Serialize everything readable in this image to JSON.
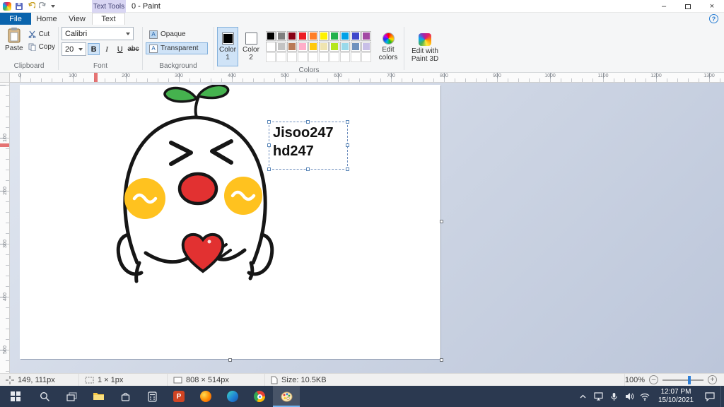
{
  "titlebar": {
    "context_badge": "Text Tools",
    "title": "0 - Paint",
    "minimize": "–",
    "close": "×"
  },
  "tabs": {
    "file": "File",
    "home": "Home",
    "view": "View",
    "text": "Text",
    "help": "?"
  },
  "ribbon": {
    "clipboard": {
      "label": "Clipboard",
      "paste": "Paste",
      "cut": "Cut",
      "copy": "Copy"
    },
    "font": {
      "label": "Font",
      "family": "Calibri",
      "size": "20",
      "bold": "B",
      "italic": "I",
      "underline": "U",
      "strike": "abc"
    },
    "background": {
      "label": "Background",
      "opaque": "Opaque",
      "transparent": "Transparent"
    },
    "colors": {
      "label": "Colors",
      "color1_label": "Color 1",
      "color2_label": "Color 2",
      "edit_label": "Edit colors",
      "color1": "#000000",
      "color2": "#ffffff",
      "palette": [
        "#000000",
        "#7f7f7f",
        "#880015",
        "#ed1c24",
        "#ff7f27",
        "#fff200",
        "#22b14c",
        "#00a2e8",
        "#3f48cc",
        "#a349a4",
        "#ffffff",
        "#c3c3c3",
        "#b97a57",
        "#ffaec9",
        "#ffc90e",
        "#efe4b0",
        "#b5e61d",
        "#99d9ea",
        "#7092be",
        "#c8bfe7",
        null,
        null,
        null,
        null,
        null,
        null,
        null,
        null,
        null,
        null
      ]
    },
    "paint3d": {
      "label": "Edit with Paint 3D"
    }
  },
  "rulers": {
    "horizontal": [
      "0",
      "100",
      "200",
      "300",
      "400",
      "500",
      "600",
      "700",
      "800",
      "900",
      "1000",
      "1100",
      "1200",
      "1300"
    ],
    "vertical": [
      "100",
      "200",
      "300",
      "400",
      "500"
    ]
  },
  "canvas": {
    "text_line1": "Jisoo247",
    "text_line2": "hd247"
  },
  "statusbar": {
    "cursor": "149, 111px",
    "selection": "1 × 1px",
    "dimensions": "808 × 514px",
    "filesize": "Size: 10.5KB",
    "zoom": "100%"
  },
  "taskbar": {
    "apps": [
      "start",
      "search",
      "task-view",
      "file-explorer",
      "store",
      "calculator",
      "powerpoint",
      "firefox",
      "edge",
      "chrome",
      "paint"
    ],
    "time": "12:07 PM",
    "date": "15/10/2021"
  }
}
